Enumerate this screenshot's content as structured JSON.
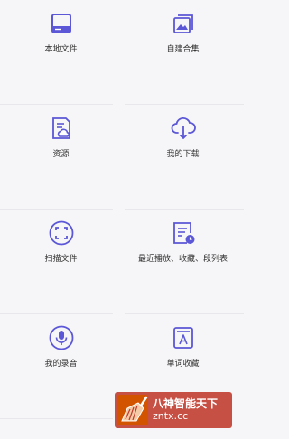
{
  "accent_color": "#5b57d6",
  "tiles": [
    {
      "label": "本地文件",
      "icon": "local-file-icon"
    },
    {
      "label": "自建合集",
      "icon": "custom-collection-icon"
    },
    {
      "label": "资源",
      "icon": "resource-icon"
    },
    {
      "label": "我的下载",
      "icon": "cloud-download-icon"
    },
    {
      "label": "扫描文件",
      "icon": "scan-icon"
    },
    {
      "label": "最近播放、收藏、段列表",
      "icon": "recent-list-icon"
    },
    {
      "label": "我的录音",
      "icon": "microphone-icon"
    },
    {
      "label": "单词收藏",
      "icon": "word-book-icon"
    }
  ],
  "watermark": {
    "title": "八神智能天下",
    "subtitle": "zntx.cc"
  }
}
